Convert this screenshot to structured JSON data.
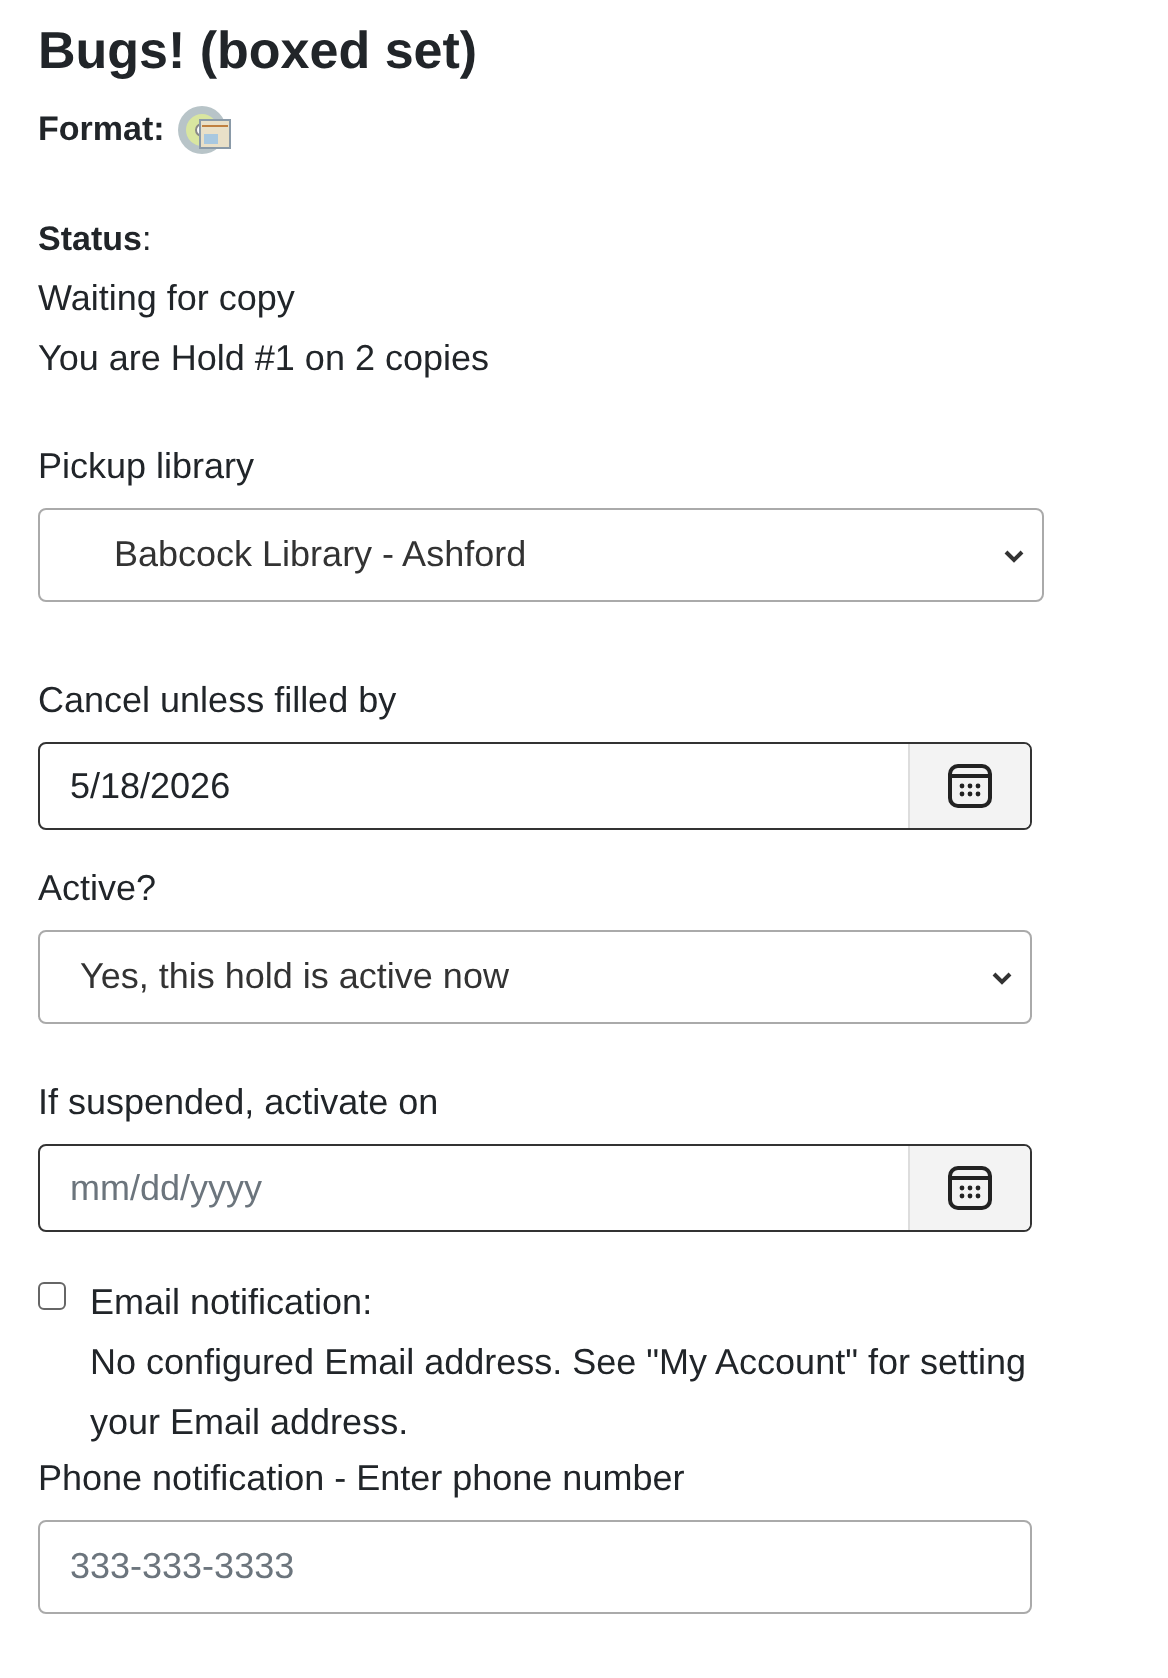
{
  "title": "Bugs! (boxed set)",
  "format": {
    "label": "Format:"
  },
  "status": {
    "label": "**Status**:",
    "lines": [
      "Waiting for copy",
      "You are Hold #1 on 2 copies"
    ]
  },
  "pickup": {
    "label": "Pickup library",
    "value": "Babcock Library - Ashford"
  },
  "cancel": {
    "label": "Cancel unless filled by",
    "value": "5/18/2026"
  },
  "active": {
    "label": "Active?",
    "value": "Yes, this hold is active now"
  },
  "suspend": {
    "label": "If suspended, activate on",
    "placeholder": "mm/dd/yyyy"
  },
  "email": {
    "label": "Email notification:",
    "checked": false,
    "note": "No configured Email address. See \"My Account\" for setting your Email address."
  },
  "phone": {
    "label": "Phone notification - Enter phone number",
    "placeholder": "333-333-3333"
  }
}
